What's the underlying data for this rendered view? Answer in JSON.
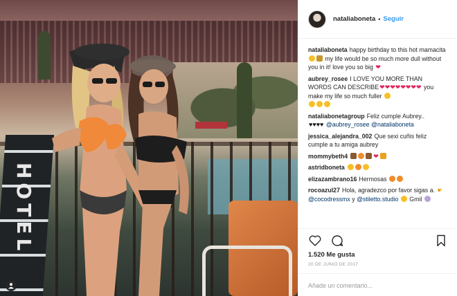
{
  "header": {
    "username": "nataliaboneta",
    "separator": "•",
    "follow_label": "Seguir"
  },
  "photo": {
    "description_icon": "user-tag-icon",
    "towel_text": "HOTEL"
  },
  "comments": [
    {
      "user": "nataliaboneta",
      "text": "happy birthday to this hot mamacita",
      "text2": "my life would be so much more dull without you in it! love you so big"
    },
    {
      "user": "aubrey_rosee",
      "text": "I LOVE YOU MORE THAN WORDS CAN DESCRIBE",
      "text2": "you make my life so much fuller"
    },
    {
      "user": "nataliabonetagroup",
      "text": "Feliz cumple Aubrey..",
      "mention1": "@aubrey_rosee",
      "mention2": "@nataliaboneta"
    },
    {
      "user": "jessica_alejandra_002",
      "text": "Que sexi cuñis feliz cumple a tu amiga aubrey"
    },
    {
      "user": "mommybeth4",
      "text": ""
    },
    {
      "user": "astridboneta",
      "text": ""
    },
    {
      "user": "elizazambrano16",
      "text": "Hermosas"
    },
    {
      "user": "rocoazul27",
      "text": "Hola, agradezco por favor sigas a.",
      "mention1": "@cocodressmx",
      "joiner": "y",
      "mention2": "@stiletto.studio",
      "text2": "Gmil"
    }
  ],
  "actions": {
    "likes": "1.520 Me gusta",
    "date": "20 DE JUNIO DE 2017",
    "comment_placeholder": "Añade un comentario..."
  },
  "colors": {
    "link": "#3897f0",
    "mention": "#003569",
    "heart": "#e0245e"
  }
}
